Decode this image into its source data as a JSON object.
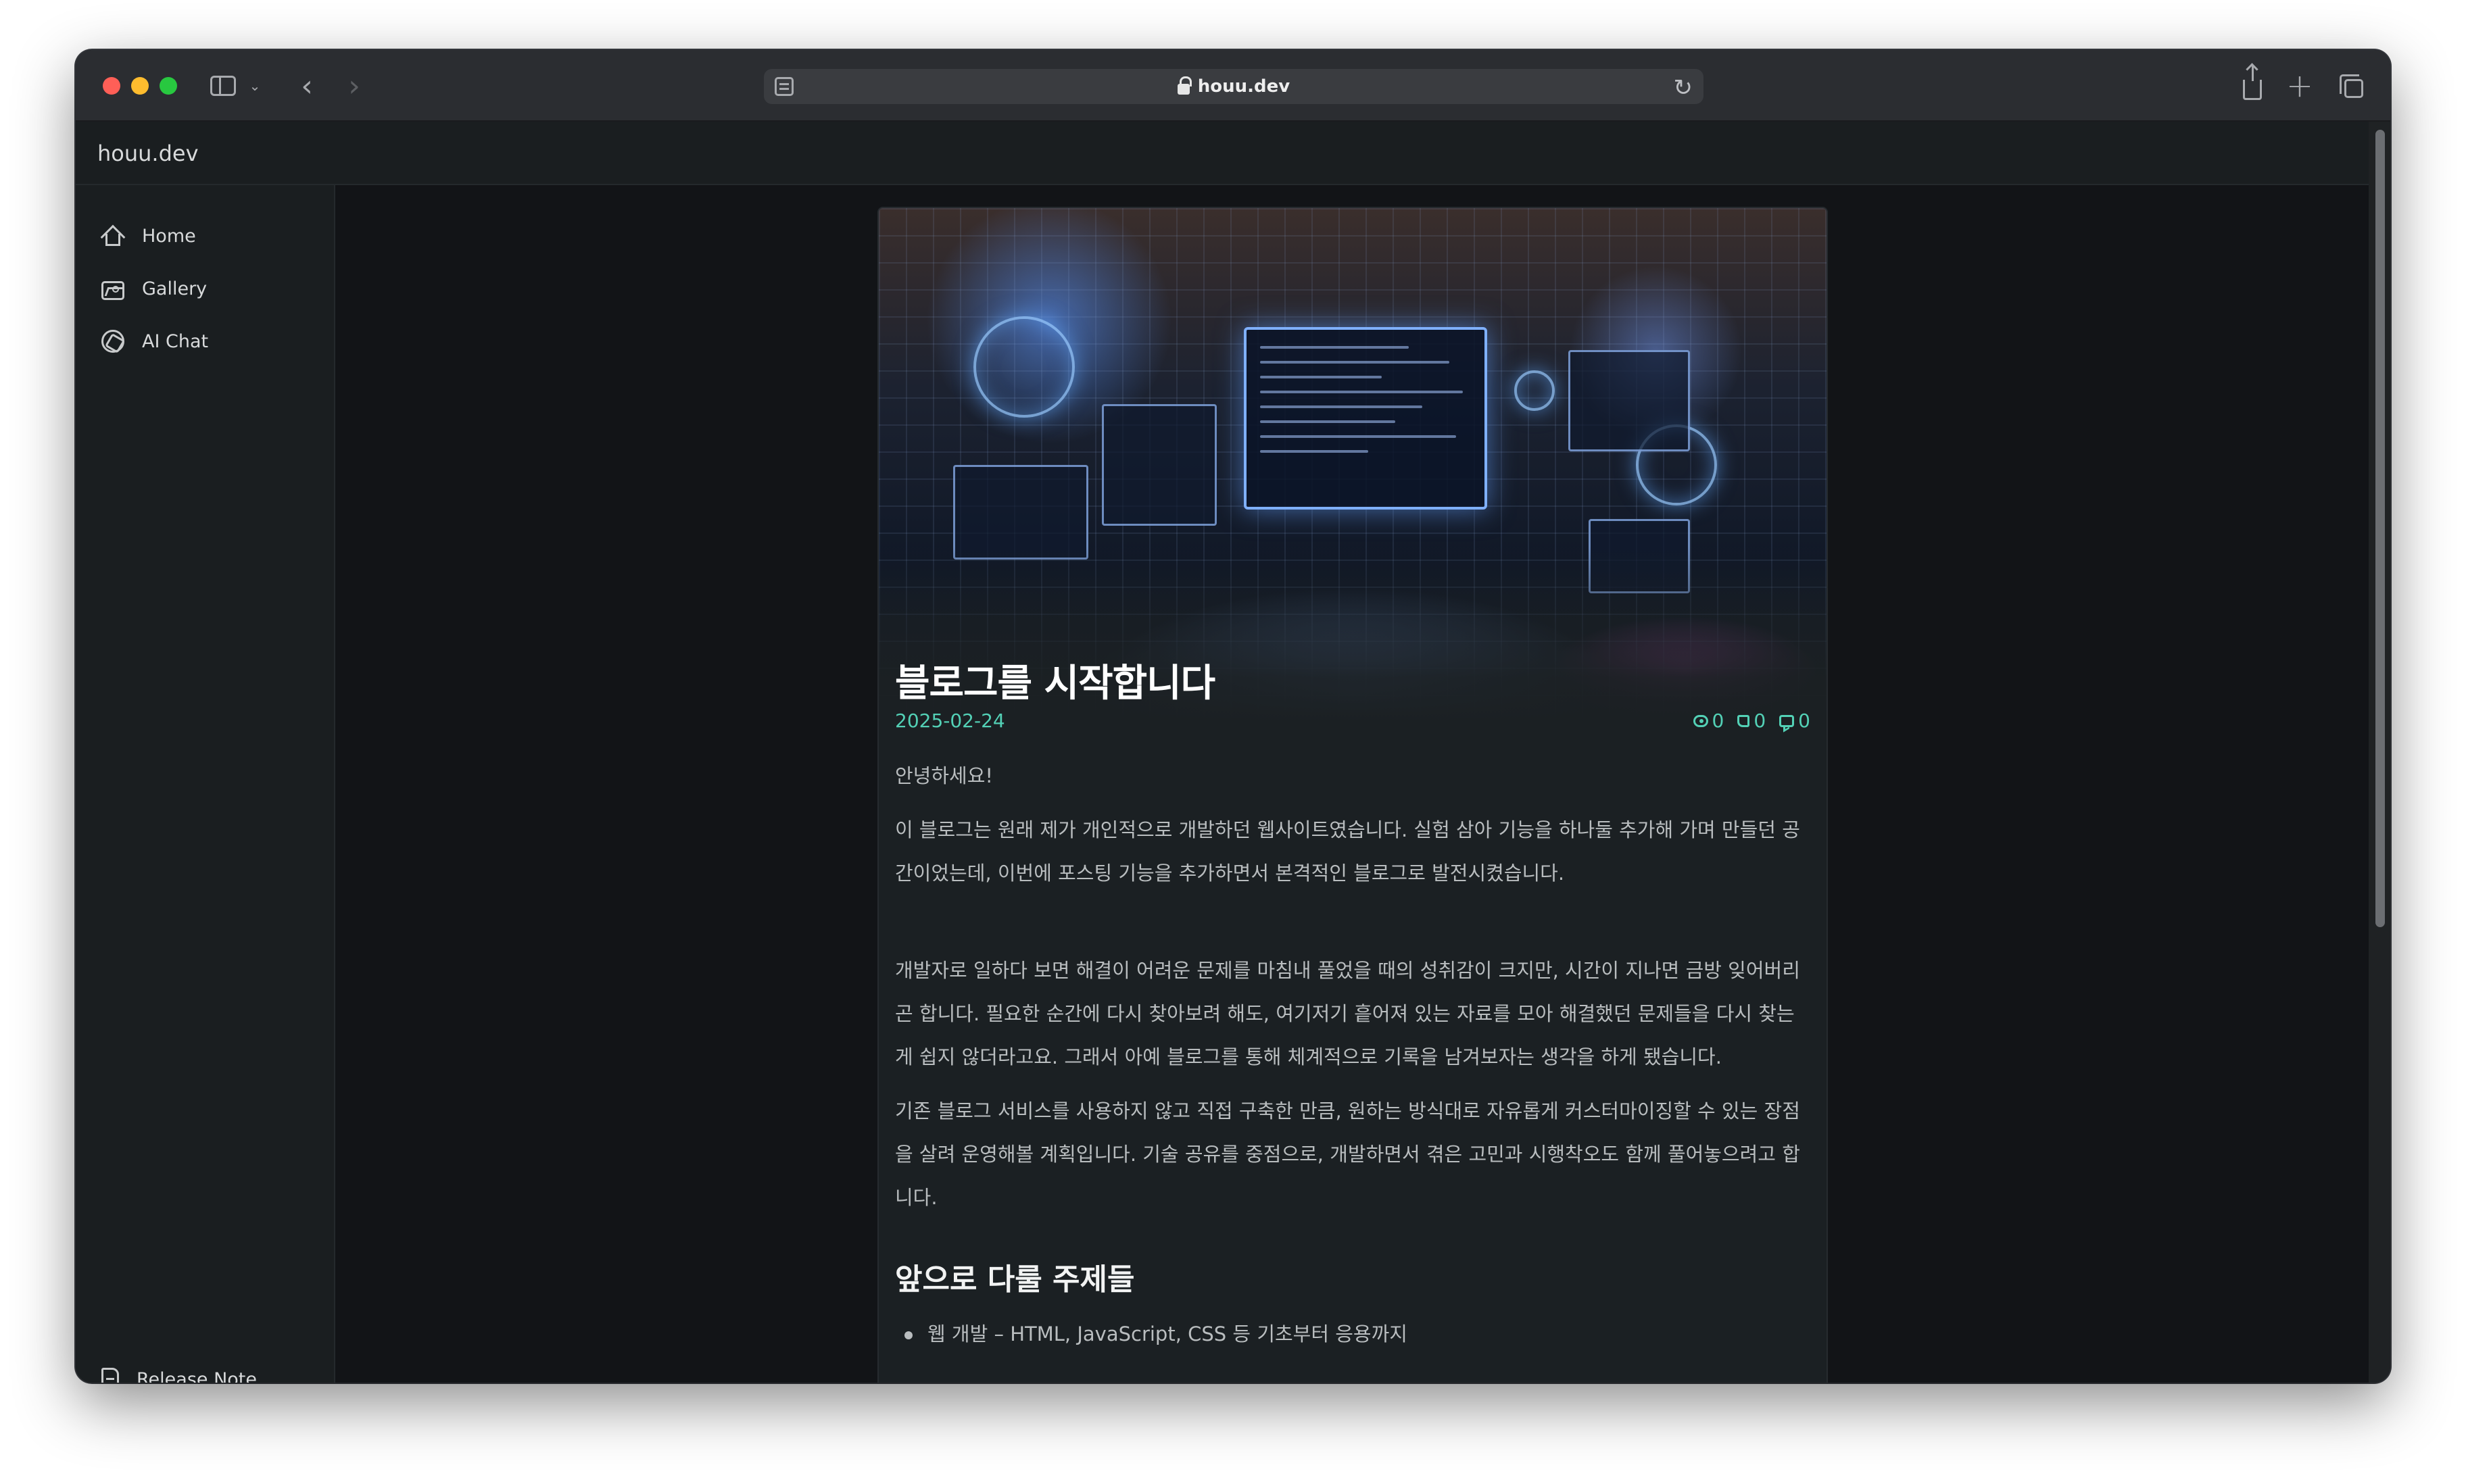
{
  "browser": {
    "url": "houu.dev"
  },
  "site": {
    "brand": "houu.dev"
  },
  "sidebar": {
    "items": [
      {
        "label": "Home",
        "icon": "home-icon"
      },
      {
        "label": "Gallery",
        "icon": "image-icon"
      },
      {
        "label": "AI Chat",
        "icon": "ai-chat-icon"
      }
    ],
    "footer_item": {
      "label": "Release Note",
      "icon": "document-icon"
    }
  },
  "post": {
    "title": "블로그를 시작합니다",
    "date": "2025-02-24",
    "views": "0",
    "likes": "0",
    "comments": "0",
    "paragraphs": [
      "안녕하세요!",
      "이 블로그는 원래 제가 개인적으로 개발하던 웹사이트였습니다. 실험 삼아 기능을 하나둘 추가해 가며 만들던 공간이었는데, 이번에 포스팅 기능을 추가하면서 본격적인 블로그로 발전시켰습니다.",
      "개발자로 일하다 보면 해결이 어려운 문제를 마침내 풀었을 때의 성취감이 크지만, 시간이 지나면 금방 잊어버리곤 합니다. 필요한 순간에 다시 찾아보려 해도, 여기저기 흩어져 있는 자료를 모아 해결했던 문제들을 다시 찾는 게 쉽지 않더라고요. 그래서 아예 블로그를 통해 체계적으로 기록을 남겨보자는 생각을 하게 됐습니다.",
      "기존 블로그 서비스를 사용하지 않고 직접 구축한 만큼, 원하는 방식대로 자유롭게 커스터마이징할 수 있는 장점을 살려 운영해볼 계획입니다. 기술 공유를 중점으로, 개발하면서 겪은 고민과 시행착오도 함께 풀어놓으려고 합니다."
    ],
    "section_heading": "앞으로 다룰 주제들",
    "list_items": [
      "웹 개발 – HTML, JavaScript, CSS 등 기초부터 응용까지"
    ]
  },
  "colors": {
    "accent": "#53d1b6",
    "background": "#121417",
    "card": "#1b2023"
  }
}
